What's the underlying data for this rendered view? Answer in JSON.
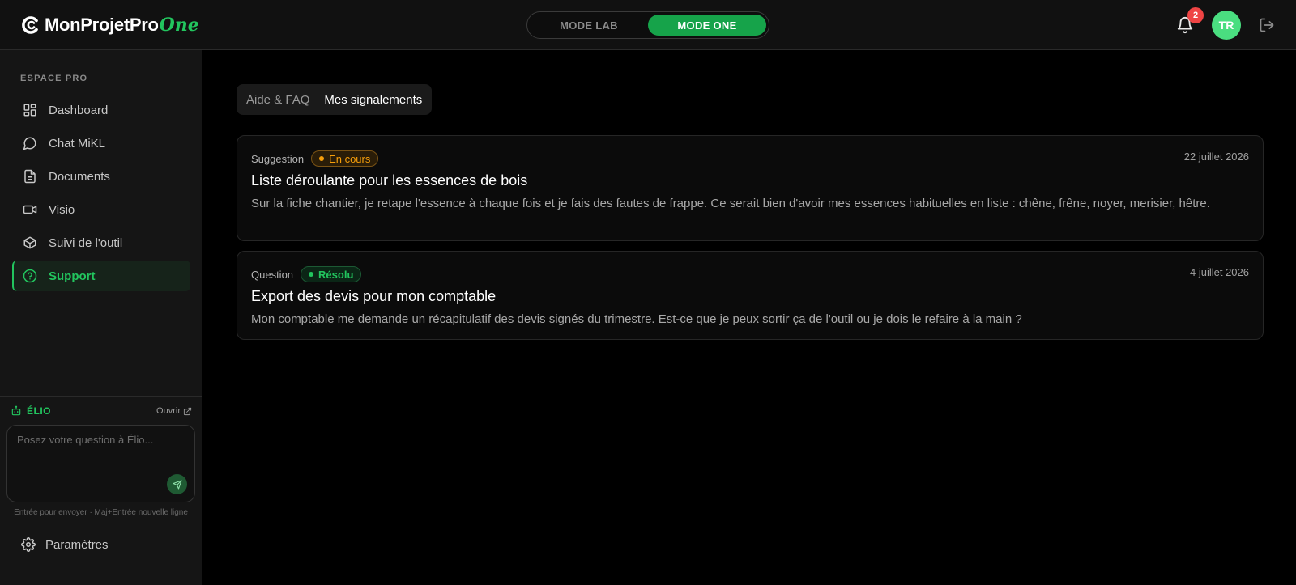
{
  "header": {
    "logo_text": "MonProjetPro",
    "logo_suffix": "One",
    "modes": [
      "MODE LAB",
      "MODE ONE"
    ],
    "active_mode": "MODE ONE",
    "notification_count": "2",
    "avatar_initials": "TR"
  },
  "sidebar": {
    "section_label": "ESPACE PRO",
    "items": [
      {
        "label": "Dashboard",
        "icon": "dashboard-icon"
      },
      {
        "label": "Chat MiKL",
        "icon": "chat-icon"
      },
      {
        "label": "Documents",
        "icon": "document-icon"
      },
      {
        "label": "Visio",
        "icon": "video-icon"
      },
      {
        "label": "Suivi de l'outil",
        "icon": "box-icon"
      },
      {
        "label": "Support",
        "icon": "help-circle-icon",
        "active": true
      }
    ],
    "elio": {
      "title": "ÉLIO",
      "open_label": "Ouvrir",
      "placeholder": "Posez votre question à Élio...",
      "hint": "Entrée pour envoyer · Maj+Entrée nouvelle ligne"
    },
    "settings_label": "Paramètres"
  },
  "tabs": [
    {
      "label": "Aide & FAQ",
      "active": false
    },
    {
      "label": "Mes signalements",
      "active": true
    }
  ],
  "reports": [
    {
      "type": "Suggestion",
      "status": "En cours",
      "date": "22 juillet 2026",
      "title": "Liste déroulante pour les essences de bois",
      "body": "Sur la fiche chantier, je retape l'essence à chaque fois et je fais des fautes de frappe. Ce serait bien d'avoir mes essences habituelles en liste : chêne, frêne, noyer, merisier, hêtre."
    },
    {
      "type": "Question",
      "status": "Résolu",
      "date": "4 juillet 2026",
      "title": "Export des devis pour mon comptable",
      "body": "Mon comptable me demande un récapitulatif des devis signés du trimestre. Est-ce que je peux sortir ça de l'outil ou je dois le refaire à la main ?"
    }
  ],
  "colors": {
    "accent": "#22c55e",
    "accent_dark": "#16a34a",
    "warning": "#f59e0b",
    "danger": "#ef4444",
    "background": "#000000",
    "sidebar": "#151515"
  }
}
